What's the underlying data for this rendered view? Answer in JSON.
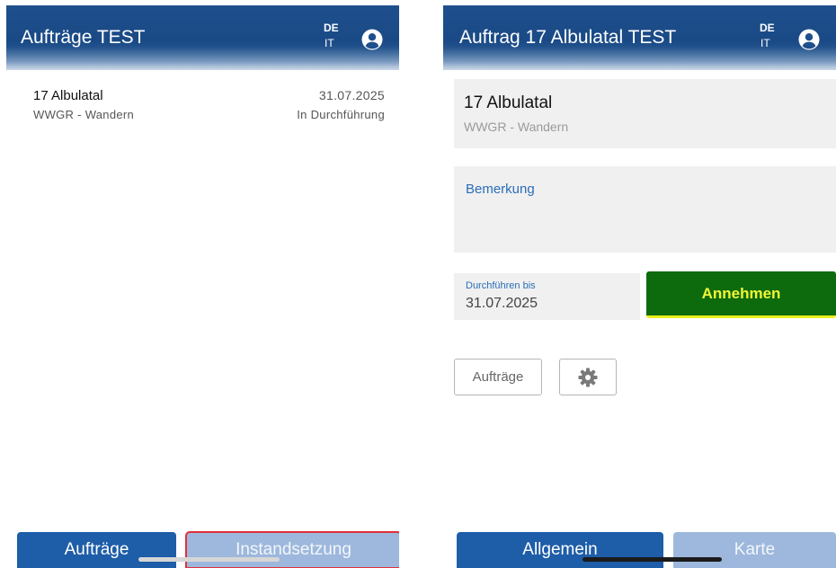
{
  "left": {
    "header": {
      "title": "Aufträge TEST",
      "lang_de": "DE",
      "lang_it": "IT"
    },
    "list": [
      {
        "title": "17 Albulatal",
        "subtitle": "WWGR - Wandern",
        "date": "31.07.2025",
        "status": "In Durchführung"
      }
    ],
    "bottom_nav": {
      "tab1": "Aufträge",
      "tab2": "Instandsetzung"
    }
  },
  "right": {
    "header": {
      "title": "Auftrag 17 Albulatal TEST",
      "lang_de": "DE",
      "lang_it": "IT"
    },
    "detail": {
      "title": "17 Albulatal",
      "subtitle": "WWGR - Wandern"
    },
    "remark_label": "Bemerkung",
    "due": {
      "label": "Durchführen bis",
      "value": "31.07.2025"
    },
    "accept_label": "Annehmen",
    "orders_button_label": "Aufträge",
    "bottom_nav": {
      "tab1": "Allgemein",
      "tab2": "Karte"
    }
  },
  "icons": {
    "user": "user-circle-icon",
    "gear": "gear-icon"
  },
  "colors": {
    "header_blue": "#1f4f8c",
    "nav_active": "#1e5da8",
    "nav_inactive": "#9db8dc",
    "accept_green": "#0d6b0d",
    "accept_text": "#f3f536",
    "link_blue": "#2a6db8",
    "highlight_red": "#e0303a"
  }
}
